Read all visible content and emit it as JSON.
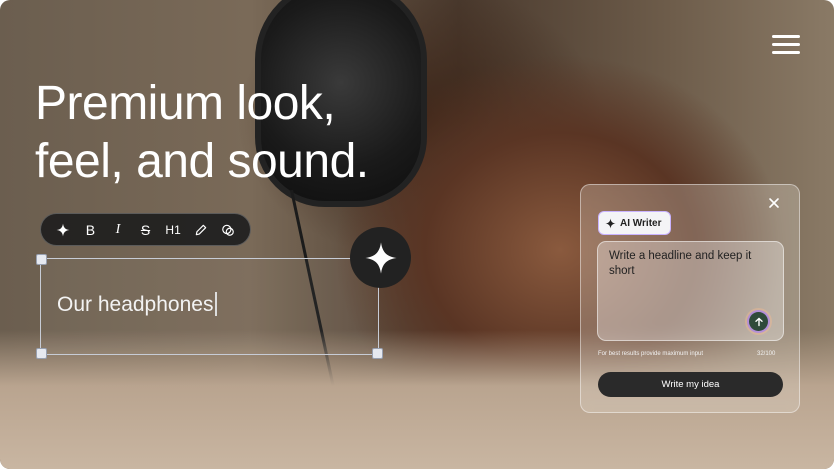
{
  "hero": {
    "headline_line1": "Premium look,",
    "headline_line2": "feel, and sound."
  },
  "toolbar": {
    "items": [
      "ai-sparkle-icon",
      "bold-icon",
      "italic-icon",
      "strikethrough-icon",
      "heading1-icon",
      "pen-icon",
      "comment-icon"
    ],
    "bold_label": "B",
    "italic_label": "I",
    "strike_label": "S",
    "h1_label": "H1"
  },
  "editor": {
    "text": "Our headphones"
  },
  "ai_writer": {
    "badge_label": "AI Writer",
    "prompt_text": "Write a headline and keep it short",
    "hint": "For best results provide maximum input",
    "char_count": "32/100",
    "submit_label": "Write my idea"
  },
  "colors": {
    "accent_border": "#c9b3ff",
    "button_dark": "#2a2a2a",
    "send_button": "#2f4a3a"
  }
}
